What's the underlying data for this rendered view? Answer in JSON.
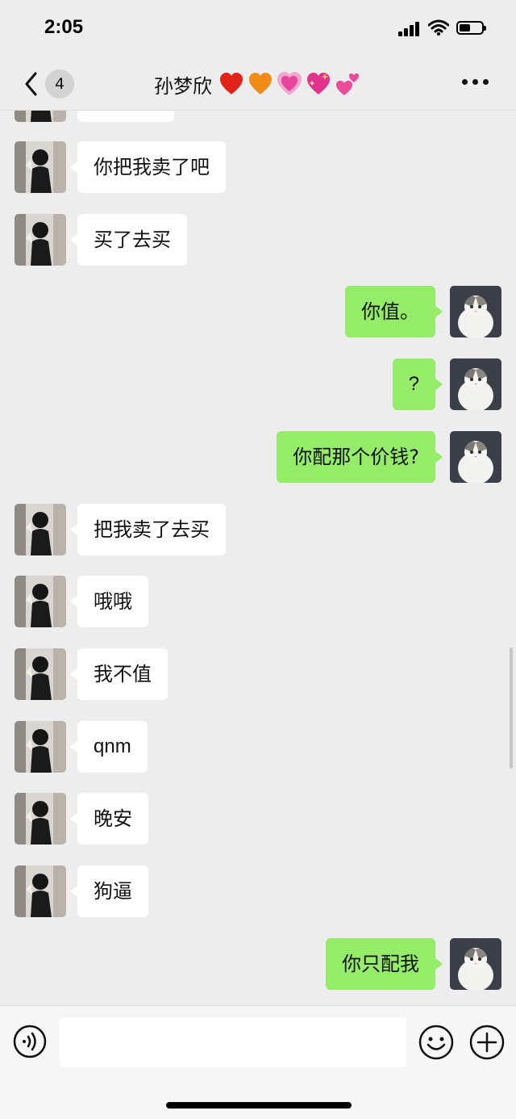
{
  "status_bar": {
    "time": "2:05",
    "icons": [
      "cellular-signal-icon",
      "wifi-icon",
      "battery-icon"
    ]
  },
  "header": {
    "unread_count": "4",
    "title": "孙梦欣",
    "title_emojis": [
      "red-heart",
      "orange-heart",
      "growing-heart",
      "sparkling-heart",
      "two-hearts"
    ],
    "back_icon": "chevron-left-icon",
    "more_icon": "ellipsis-icon"
  },
  "messages": [
    {
      "side": "in",
      "text": "你把我卖了吧"
    },
    {
      "side": "in",
      "text": "买了去买"
    },
    {
      "side": "out",
      "text": "你值。"
    },
    {
      "side": "out",
      "text": "?"
    },
    {
      "side": "out",
      "text": "你配那个价钱?"
    },
    {
      "side": "in",
      "text": "把我卖了去买"
    },
    {
      "side": "in",
      "text": "哦哦"
    },
    {
      "side": "in",
      "text": "我不值"
    },
    {
      "side": "in",
      "text": "qnm"
    },
    {
      "side": "in",
      "text": "晚安"
    },
    {
      "side": "in",
      "text": "狗逼"
    },
    {
      "side": "out",
      "text": "你只配我"
    }
  ],
  "input_bar": {
    "value": "",
    "placeholder": "",
    "icons": [
      "voice-icon",
      "emoji-icon",
      "plus-icon"
    ]
  },
  "colors": {
    "background": "#ededed",
    "incoming_bubble": "#ffffff",
    "outgoing_bubble": "#95ec69",
    "input_bar": "#f6f6f6"
  }
}
